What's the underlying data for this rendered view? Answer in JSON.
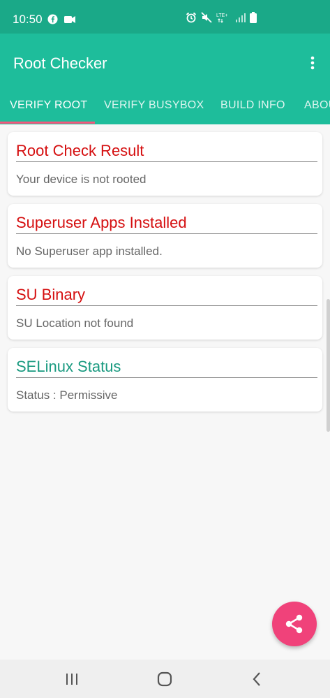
{
  "status_bar": {
    "time": "10:50",
    "left_icons": [
      "facebook-icon",
      "video-icon"
    ],
    "right_icons": [
      "alarm-icon",
      "mute-icon",
      "lte-icon",
      "signal-icon",
      "battery-icon"
    ],
    "network_label": "LTE+"
  },
  "app_bar": {
    "title": "Root Checker",
    "menu_icon": "more-vert-icon"
  },
  "tabs": [
    {
      "label": "VERIFY ROOT",
      "active": true
    },
    {
      "label": "VERIFY BUSYBOX",
      "active": false
    },
    {
      "label": "BUILD INFO",
      "active": false
    },
    {
      "label": "ABOUT",
      "active": false
    }
  ],
  "cards": [
    {
      "title": "Root Check Result",
      "body": "Your device is not rooted",
      "status": "red"
    },
    {
      "title": "Superuser Apps Installed",
      "body": "No Superuser app installed.",
      "status": "red"
    },
    {
      "title": "SU Binary",
      "body": "SU Location not found",
      "status": "red"
    },
    {
      "title": "SELinux Status",
      "body": "Status : Permissive",
      "status": "green"
    }
  ],
  "fab": {
    "icon": "share-icon"
  },
  "nav_bar": {
    "icons": [
      "recent-apps-icon",
      "home-icon",
      "back-icon"
    ]
  },
  "colors": {
    "status_bar": "#1aa988",
    "app_bar": "#1ebd9b",
    "tab_indicator": "#f3577c",
    "error_red": "#d50f10",
    "ok_green": "#1a9a80",
    "fab": "#f0427a"
  }
}
